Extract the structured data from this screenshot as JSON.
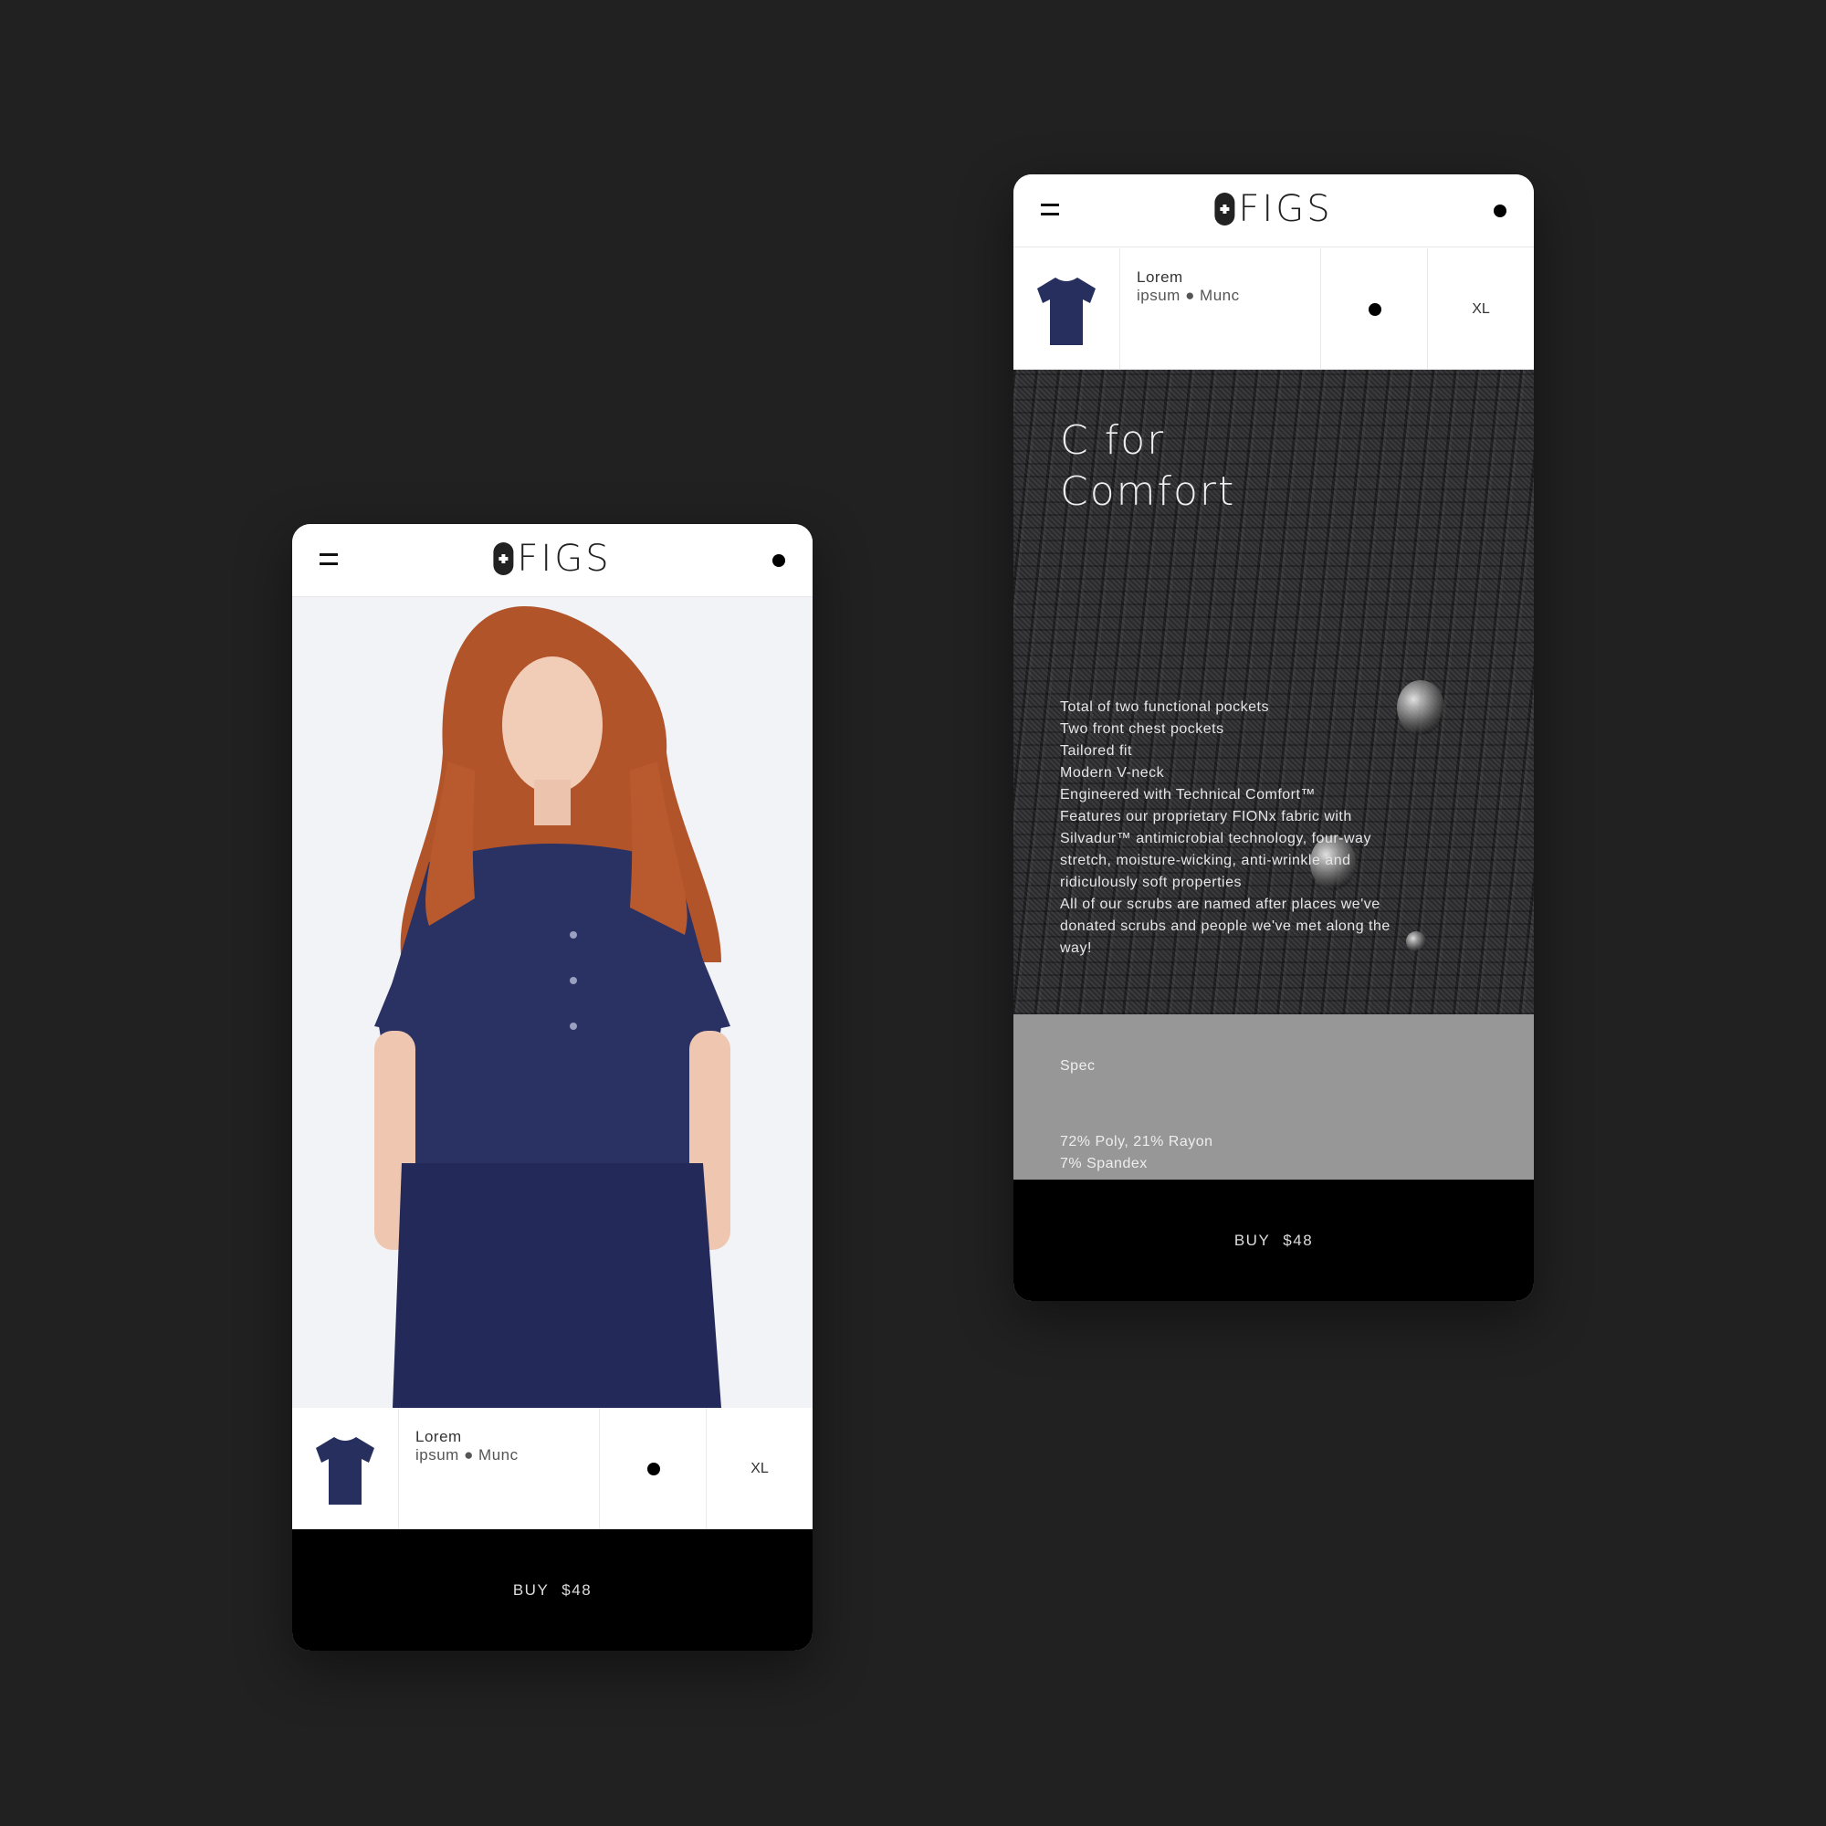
{
  "brand": {
    "logo_text": "FIGS"
  },
  "colors": {
    "background": "#212121",
    "buy_bar": "#000000",
    "spec_panel": "#979797",
    "scrub_navy": "#262f5e"
  },
  "product": {
    "name": "Lorem",
    "meta": "ipsum ● Munc",
    "size": "XL",
    "color_swatch": "#000000"
  },
  "buy": {
    "label": "BUY",
    "price": "$48"
  },
  "detail": {
    "headline_line1": "C for",
    "headline_line2": "Comfort",
    "features": [
      "Total of two functional pockets",
      "Two front chest pockets",
      "Tailored fit",
      "Modern V-neck",
      "Engineered with Technical Comfort™",
      "Features our proprietary FIONx fabric with Silvadur™ antimicrobial technology, four-way stretch, moisture-wicking, anti-wrinkle and ridiculously soft properties",
      "All of our scrubs are named after places we've donated scrubs and people we've met along the way!"
    ],
    "spec_title": "Spec",
    "spec_items": [
      "72% Poly, 21% Rayon",
      "7% Spandex"
    ]
  },
  "icons": {
    "menu": "hamburger-icon",
    "account": "dot-icon",
    "logo": "figs-cross-logo"
  }
}
